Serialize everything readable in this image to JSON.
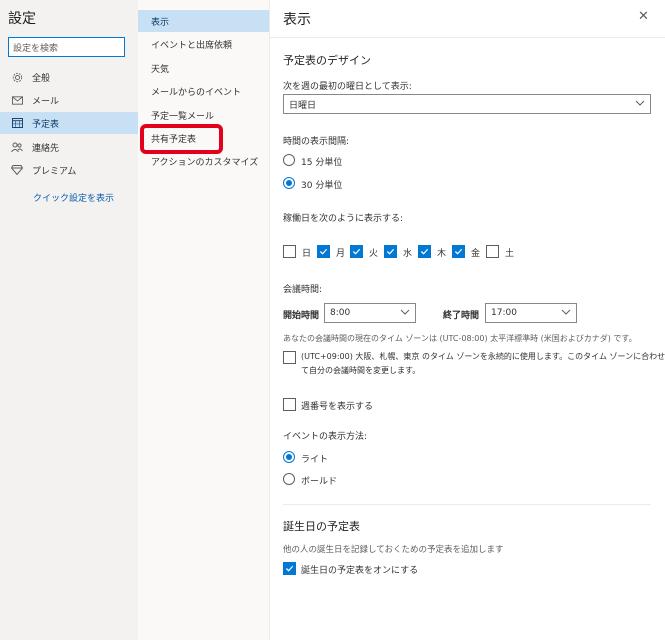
{
  "left_nav": {
    "title": "設定",
    "search_placeholder": "設定を検索",
    "items": [
      {
        "label": "全般",
        "icon": "gear-icon"
      },
      {
        "label": "メール",
        "icon": "mail-icon"
      },
      {
        "label": "予定表",
        "icon": "calendar-icon"
      },
      {
        "label": "連絡先",
        "icon": "people-icon"
      },
      {
        "label": "プレミアム",
        "icon": "diamond-icon"
      }
    ],
    "selected": "予定表",
    "quick_settings": "クイック設定を表示"
  },
  "sub_nav": {
    "items": [
      "表示",
      "イベントと出席依頼",
      "天気",
      "メールからのイベント",
      "予定一覧メール",
      "共有予定表",
      "アクションのカスタマイズ"
    ],
    "selected": "表示",
    "highlighted": "共有予定表",
    "highlight_color": "#e3001b"
  },
  "panel": {
    "title": "表示",
    "design_heading": "予定表のデザイン",
    "first_day_label": "次を週の最初の曜日として表示:",
    "first_day_value": "日曜日",
    "interval_label": "時間の表示間隔:",
    "interval_options": [
      "15 分単位",
      "30 分単位"
    ],
    "interval_selected": "30 分単位",
    "workdays_label": "稼働日を次のように表示する:",
    "days": [
      {
        "label": "日",
        "checked": false
      },
      {
        "label": "月",
        "checked": true
      },
      {
        "label": "火",
        "checked": true
      },
      {
        "label": "水",
        "checked": true
      },
      {
        "label": "木",
        "checked": true
      },
      {
        "label": "金",
        "checked": true
      },
      {
        "label": "土",
        "checked": false
      }
    ],
    "meeting_label": "会議時間:",
    "start_label": "開始時間",
    "start_value": "8:00",
    "end_label": "終了時間",
    "end_value": "17:00",
    "timezone_note": "あなたの会議時間の現在のタイム ゾーンは (UTC-08:00) 太平洋標準時 (米国およびカナダ) です。",
    "timezone_option_line1": "(UTC+09:00) 大阪、札幌、東京 のタイム ゾーンを永続的に使用します。このタイム ゾーンに合わせ",
    "timezone_option_line2": "て自分の会議時間を変更します。",
    "week_number_label": "週番号を表示する",
    "event_display_label": "イベントの表示方法:",
    "event_options": [
      "ライト",
      "ボールド"
    ],
    "event_selected": "ライト",
    "birthday_heading": "誕生日の予定表",
    "birthday_desc": "他の人の誕生日を記録しておくための予定表を追加します",
    "birthday_toggle_label": "誕生日の予定表をオンにする",
    "accent_color": "#0078d4"
  }
}
